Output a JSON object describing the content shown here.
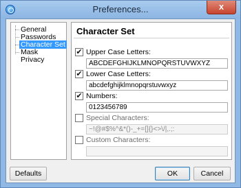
{
  "window": {
    "title": "Preferences...",
    "close_label": "x"
  },
  "nav": {
    "items": [
      {
        "label": "General"
      },
      {
        "label": "Passwords"
      },
      {
        "label": "Character Set"
      },
      {
        "label": "Mask"
      },
      {
        "label": "Privacy"
      }
    ],
    "selected": "Character Set"
  },
  "panel": {
    "title": "Character Set",
    "options": [
      {
        "label": "Upper Case Letters:",
        "checked": true,
        "check": "✔",
        "value": "ABCDEFGHIJKLMNOPQRSTUVWXYZ",
        "enabled": true
      },
      {
        "label": "Lower Case Letters:",
        "checked": true,
        "check": "✔",
        "value": "abcdefghijklmnopqrstuvwxyz",
        "enabled": true
      },
      {
        "label": "Numbers:",
        "checked": true,
        "check": "✔",
        "value": "0123456789",
        "enabled": true
      },
      {
        "label": "Special Characters:",
        "checked": false,
        "check": "",
        "value": "~!@#$%^&*()-_+=[]{}<>\\/|,.;:",
        "enabled": false
      },
      {
        "label": "Custom Characters:",
        "checked": false,
        "check": "",
        "value": "",
        "enabled": false
      }
    ]
  },
  "buttons": {
    "defaults": "Defaults",
    "ok": "OK",
    "cancel": "Cancel"
  }
}
